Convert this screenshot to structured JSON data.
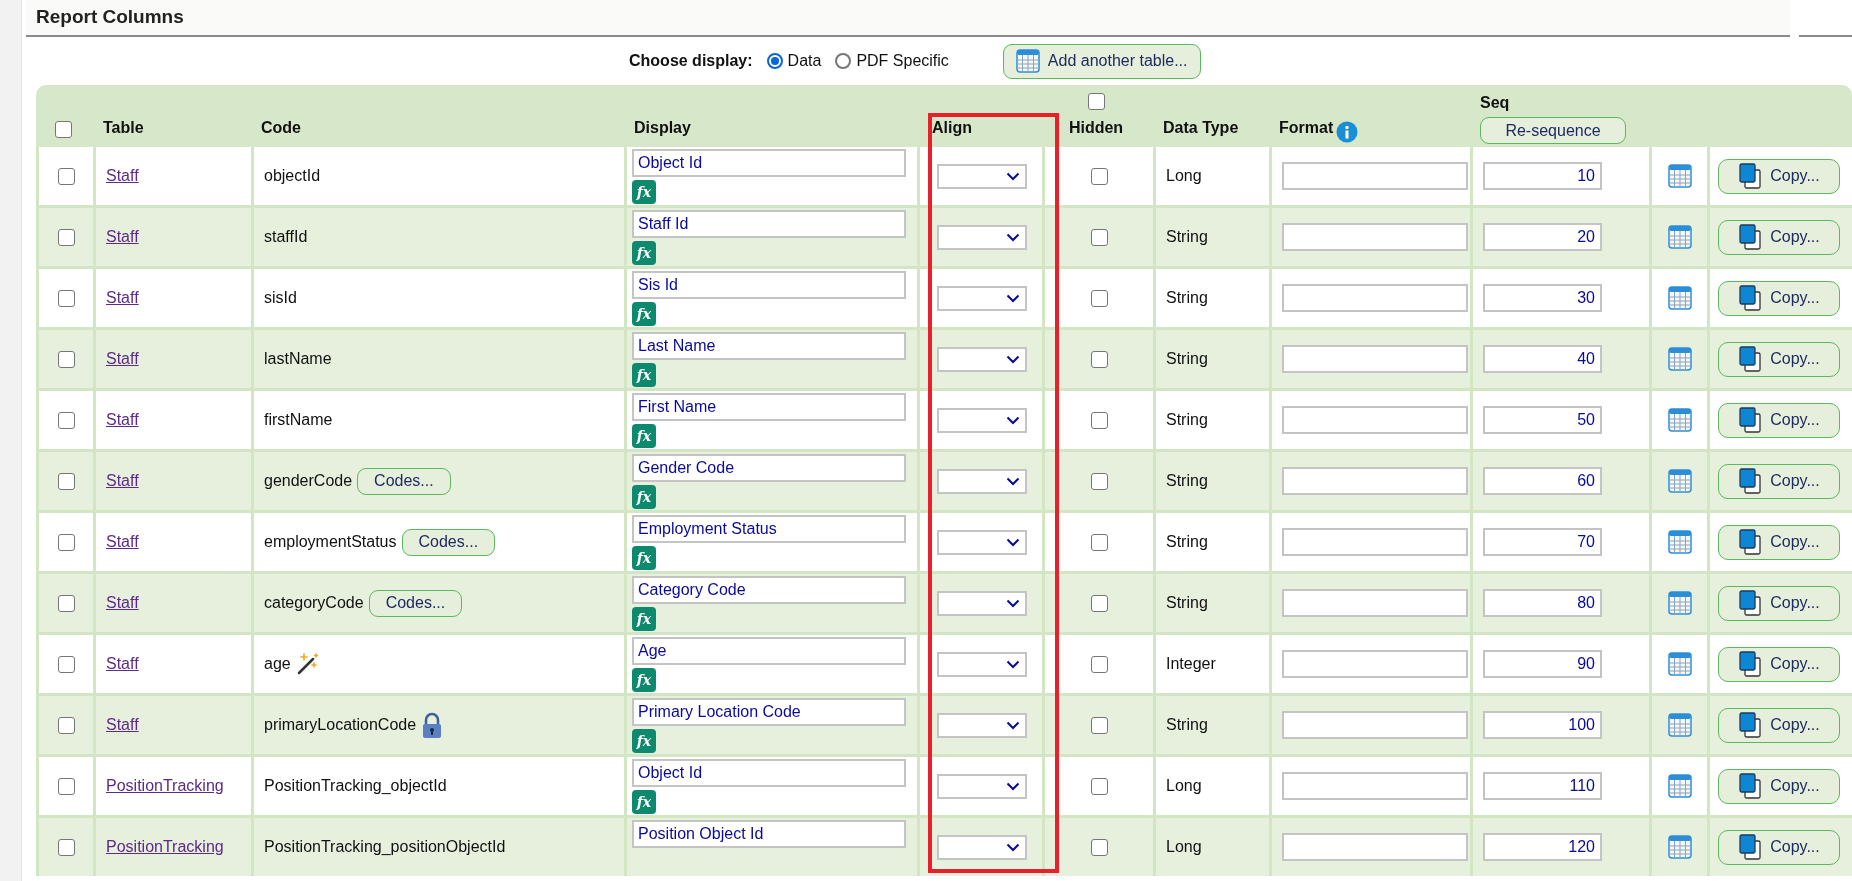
{
  "section_title": "Report Columns",
  "display_choice": {
    "label": "Choose display:",
    "options": [
      {
        "label": "Data",
        "selected": true
      },
      {
        "label": "PDF Specific",
        "selected": false
      }
    ]
  },
  "add_table_button": "Add another table...",
  "table": {
    "select_all_checked": false,
    "hidden_all_checked": false,
    "resequence_button": "Re-sequence",
    "columns": [
      "Table",
      "Code",
      "Display",
      "Align",
      "Hidden",
      "Data Type",
      "Format",
      "Seq"
    ],
    "rows": [
      {
        "checked": false,
        "table": "Staff",
        "code": "objectId",
        "calculated": false,
        "locked": false,
        "display": "Object Id",
        "formula": "fx",
        "hidden": false,
        "data_type": "Long",
        "seq": "10",
        "copy": "Copy..."
      },
      {
        "checked": false,
        "table": "Staff",
        "code": "staffId",
        "calculated": false,
        "locked": false,
        "display": "Staff Id",
        "formula": "fx",
        "hidden": false,
        "data_type": "String",
        "seq": "20",
        "copy": "Copy..."
      },
      {
        "checked": false,
        "table": "Staff",
        "code": "sisId",
        "calculated": false,
        "locked": false,
        "display": "Sis Id",
        "formula": "fx",
        "hidden": false,
        "data_type": "String",
        "seq": "30",
        "copy": "Copy..."
      },
      {
        "checked": false,
        "table": "Staff",
        "code": "lastName",
        "calculated": false,
        "locked": false,
        "display": "Last Name",
        "formula": "fx",
        "hidden": false,
        "data_type": "String",
        "seq": "40",
        "copy": "Copy..."
      },
      {
        "checked": false,
        "table": "Staff",
        "code": "firstName",
        "calculated": false,
        "locked": false,
        "display": "First Name",
        "formula": "fx",
        "hidden": false,
        "data_type": "String",
        "seq": "50",
        "copy": "Copy..."
      },
      {
        "checked": false,
        "table": "Staff",
        "code": "genderCode",
        "calculated": false,
        "locked": false,
        "codes_button": "Codes...",
        "display": "Gender Code",
        "formula": "fx",
        "hidden": false,
        "data_type": "String",
        "seq": "60",
        "copy": "Copy..."
      },
      {
        "checked": false,
        "table": "Staff",
        "code": "employmentStatus",
        "calculated": false,
        "locked": false,
        "codes_button": "Codes...",
        "display": "Employment Status",
        "formula": "fx",
        "hidden": false,
        "data_type": "String",
        "seq": "70",
        "copy": "Copy..."
      },
      {
        "checked": false,
        "table": "Staff",
        "code": "categoryCode",
        "calculated": false,
        "locked": false,
        "codes_button": "Codes...",
        "display": "Category Code",
        "formula": "fx",
        "hidden": false,
        "data_type": "String",
        "seq": "80",
        "copy": "Copy..."
      },
      {
        "checked": false,
        "table": "Staff",
        "code": "age",
        "calculated": true,
        "locked": false,
        "display": "Age",
        "formula": "fx",
        "hidden": false,
        "data_type": "Integer",
        "seq": "90",
        "copy": "Copy..."
      },
      {
        "checked": false,
        "table": "Staff",
        "code": "primaryLocationCode",
        "calculated": false,
        "locked": true,
        "display": "Primary Location Code",
        "formula": "fx",
        "hidden": false,
        "data_type": "String",
        "seq": "100",
        "copy": "Copy..."
      },
      {
        "checked": false,
        "table": "PositionTracking",
        "code": "PositionTracking_objectId",
        "calculated": false,
        "locked": false,
        "display": "Object Id",
        "formula": "fx",
        "hidden": false,
        "data_type": "Long",
        "seq": "110",
        "copy": "Copy..."
      },
      {
        "checked": false,
        "table": "PositionTracking",
        "code": "PositionTracking_positionObjectId",
        "calculated": false,
        "locked": false,
        "display": "Position Object Id",
        "hidden": false,
        "data_type": "Long",
        "seq": "120",
        "copy": "Copy..."
      }
    ]
  }
}
